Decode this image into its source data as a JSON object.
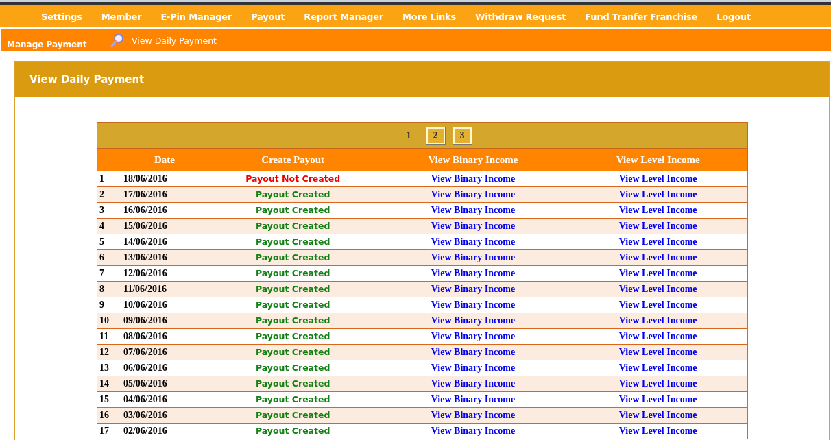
{
  "nav": [
    "Settings",
    "Member",
    "E-Pin Manager",
    "Payout",
    "Report Manager",
    "More Links",
    "Withdraw Request",
    "Fund Tranfer Franchise",
    "Logout"
  ],
  "subbar": {
    "section": "Manage Payment",
    "link": "View Daily Payment"
  },
  "panel": {
    "title": "View Daily Payment"
  },
  "pages": [
    {
      "label": "1",
      "selected": true
    },
    {
      "label": "2",
      "selected": false
    },
    {
      "label": "3",
      "selected": false
    }
  ],
  "table": {
    "columns": [
      "",
      "Date",
      "Create Payout",
      "View Binary Income",
      "View Level Income"
    ],
    "rows": [
      {
        "no": "1",
        "date": "18/06/2016",
        "payout": "Payout Not Created",
        "created": false,
        "binary": "View Binary Income",
        "level": "View Level Income"
      },
      {
        "no": "2",
        "date": "17/06/2016",
        "payout": "Payout Created",
        "created": true,
        "binary": "View Binary Income",
        "level": "View Level Income"
      },
      {
        "no": "3",
        "date": "16/06/2016",
        "payout": "Payout Created",
        "created": true,
        "binary": "View Binary Income",
        "level": "View Level Income"
      },
      {
        "no": "4",
        "date": "15/06/2016",
        "payout": "Payout Created",
        "created": true,
        "binary": "View Binary Income",
        "level": "View Level Income"
      },
      {
        "no": "5",
        "date": "14/06/2016",
        "payout": "Payout Created",
        "created": true,
        "binary": "View Binary Income",
        "level": "View Level Income"
      },
      {
        "no": "6",
        "date": "13/06/2016",
        "payout": "Payout Created",
        "created": true,
        "binary": "View Binary Income",
        "level": "View Level Income"
      },
      {
        "no": "7",
        "date": "12/06/2016",
        "payout": "Payout Created",
        "created": true,
        "binary": "View Binary Income",
        "level": "View Level Income"
      },
      {
        "no": "8",
        "date": "11/06/2016",
        "payout": "Payout Created",
        "created": true,
        "binary": "View Binary Income",
        "level": "View Level Income"
      },
      {
        "no": "9",
        "date": "10/06/2016",
        "payout": "Payout Created",
        "created": true,
        "binary": "View Binary Income",
        "level": "View Level Income"
      },
      {
        "no": "10",
        "date": "09/06/2016",
        "payout": "Payout Created",
        "created": true,
        "binary": "View Binary Income",
        "level": "View Level Income"
      },
      {
        "no": "11",
        "date": "08/06/2016",
        "payout": "Payout Created",
        "created": true,
        "binary": "View Binary Income",
        "level": "View Level Income"
      },
      {
        "no": "12",
        "date": "07/06/2016",
        "payout": "Payout Created",
        "created": true,
        "binary": "View Binary Income",
        "level": "View Level Income"
      },
      {
        "no": "13",
        "date": "06/06/2016",
        "payout": "Payout Created",
        "created": true,
        "binary": "View Binary Income",
        "level": "View Level Income"
      },
      {
        "no": "14",
        "date": "05/06/2016",
        "payout": "Payout Created",
        "created": true,
        "binary": "View Binary Income",
        "level": "View Level Income"
      },
      {
        "no": "15",
        "date": "04/06/2016",
        "payout": "Payout Created",
        "created": true,
        "binary": "View Binary Income",
        "level": "View Level Income"
      },
      {
        "no": "16",
        "date": "03/06/2016",
        "payout": "Payout Created",
        "created": true,
        "binary": "View Binary Income",
        "level": "View Level Income"
      },
      {
        "no": "17",
        "date": "02/06/2016",
        "payout": "Payout Created",
        "created": true,
        "binary": "View Binary Income",
        "level": "View Level Income"
      }
    ]
  }
}
